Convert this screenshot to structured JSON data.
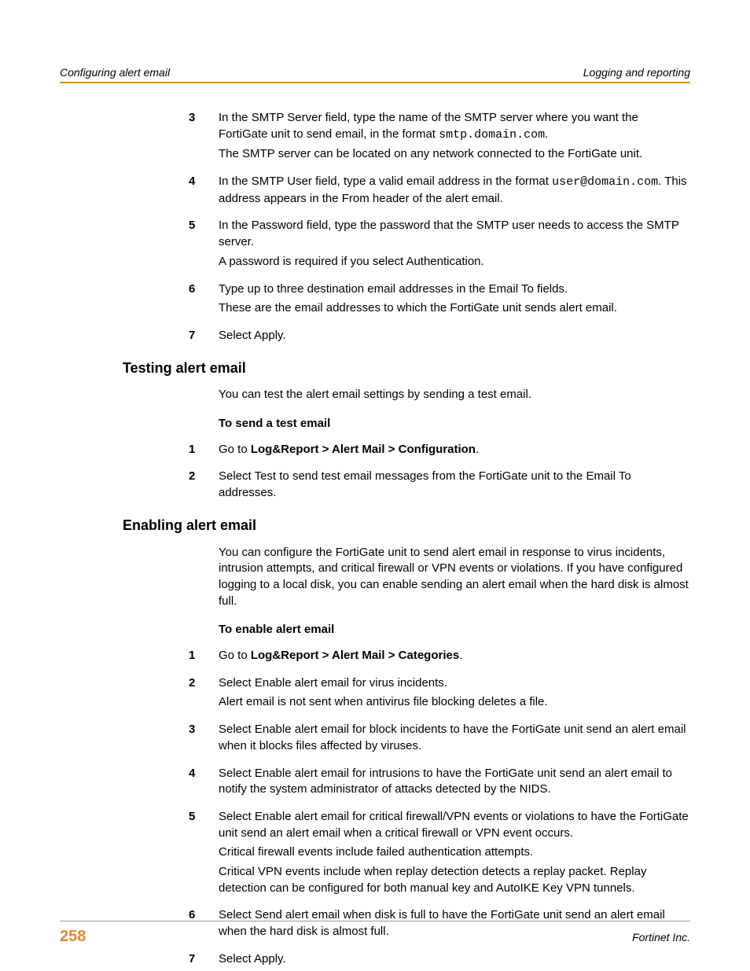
{
  "header": {
    "left": "Configuring alert email",
    "right": "Logging and reporting"
  },
  "top_steps": [
    {
      "n": "3",
      "paras": [
        {
          "type": "mixed",
          "parts": [
            {
              "t": "In the SMTP Server field, type the name of the SMTP server where you want the FortiGate unit to send email, in the format "
            },
            {
              "t": "smtp.domain.com",
              "mono": true
            },
            {
              "t": "."
            }
          ]
        },
        {
          "type": "plain",
          "text": "The SMTP server can be located on any network connected to the FortiGate unit."
        }
      ]
    },
    {
      "n": "4",
      "paras": [
        {
          "type": "mixed",
          "parts": [
            {
              "t": "In the SMTP User field, type a valid email address in the format "
            },
            {
              "t": "user@domain.com",
              "mono": true
            },
            {
              "t": ". This address appears in the From header of the alert email."
            }
          ]
        }
      ]
    },
    {
      "n": "5",
      "paras": [
        {
          "type": "plain",
          "text": "In the Password field, type the password that the SMTP user needs to access the SMTP server."
        },
        {
          "type": "plain",
          "text": "A password is required if you select Authentication."
        }
      ]
    },
    {
      "n": "6",
      "paras": [
        {
          "type": "plain",
          "text": "Type up to three destination email addresses in the Email To fields."
        },
        {
          "type": "plain",
          "text": "These are the email addresses to which the FortiGate unit sends alert email."
        }
      ]
    },
    {
      "n": "7",
      "paras": [
        {
          "type": "plain",
          "text": "Select Apply."
        }
      ]
    }
  ],
  "section_testing": {
    "heading": "Testing alert email",
    "intro": "You can test the alert email settings by sending a test email.",
    "subhead": "To send a test email",
    "steps": [
      {
        "n": "1",
        "paras": [
          {
            "type": "mixed",
            "parts": [
              {
                "t": "Go to "
              },
              {
                "t": "Log&Report > Alert Mail > Configuration",
                "bold": true
              },
              {
                "t": "."
              }
            ]
          }
        ]
      },
      {
        "n": "2",
        "paras": [
          {
            "type": "plain",
            "text": "Select Test to send test email messages from the FortiGate unit to the Email To addresses."
          }
        ]
      }
    ]
  },
  "section_enabling": {
    "heading": "Enabling alert email",
    "intro": "You can configure the FortiGate unit to send alert email in response to virus incidents, intrusion attempts, and critical firewall or VPN events or violations. If you have configured logging to a local disk, you can enable sending an alert email when the hard disk is almost full.",
    "subhead": "To enable alert email",
    "steps": [
      {
        "n": "1",
        "paras": [
          {
            "type": "mixed",
            "parts": [
              {
                "t": "Go to "
              },
              {
                "t": "Log&Report > Alert Mail > Categories",
                "bold": true
              },
              {
                "t": "."
              }
            ]
          }
        ]
      },
      {
        "n": "2",
        "paras": [
          {
            "type": "plain",
            "text": "Select Enable alert email for virus incidents."
          },
          {
            "type": "plain",
            "text": "Alert email is not sent when antivirus file blocking deletes a file."
          }
        ]
      },
      {
        "n": "3",
        "paras": [
          {
            "type": "plain",
            "text": "Select Enable alert email for block incidents to have the FortiGate unit send an alert email when it blocks files affected by viruses."
          }
        ]
      },
      {
        "n": "4",
        "paras": [
          {
            "type": "plain",
            "text": "Select Enable alert email for intrusions to have the FortiGate unit send an alert email to notify the system administrator of attacks detected by the NIDS."
          }
        ]
      },
      {
        "n": "5",
        "paras": [
          {
            "type": "plain",
            "text": "Select Enable alert email for critical firewall/VPN events or violations to have the FortiGate unit send an alert email when a critical firewall or VPN event occurs."
          },
          {
            "type": "plain",
            "text": "Critical firewall events include failed authentication attempts."
          },
          {
            "type": "plain",
            "text": "Critical VPN events include when replay detection detects a replay packet. Replay detection can be configured for both manual key and AutoIKE Key VPN tunnels."
          }
        ]
      },
      {
        "n": "6",
        "paras": [
          {
            "type": "plain",
            "text": "Select Send alert email when disk is full to have the FortiGate unit send an alert email when the hard disk is almost full."
          }
        ]
      },
      {
        "n": "7",
        "paras": [
          {
            "type": "plain",
            "text": "Select Apply."
          }
        ]
      }
    ]
  },
  "footer": {
    "page": "258",
    "company": "Fortinet Inc."
  }
}
